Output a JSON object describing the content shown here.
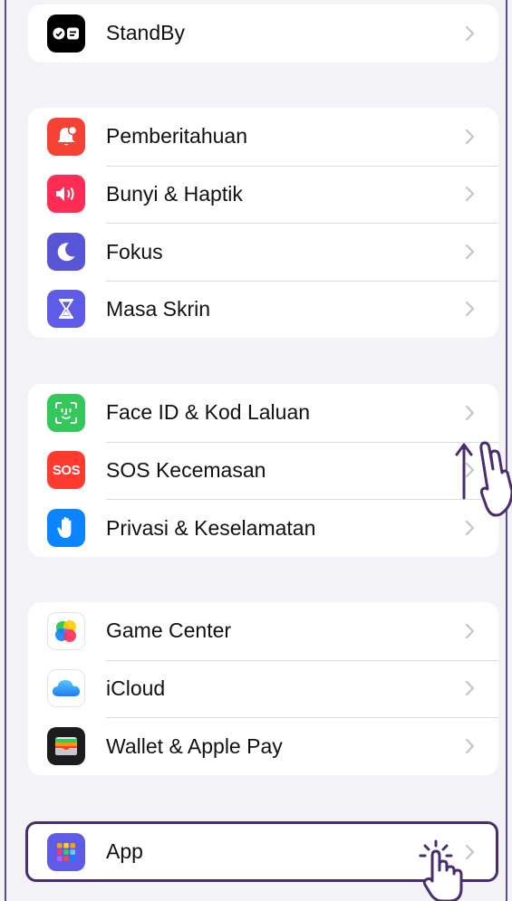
{
  "groups": [
    {
      "items": [
        {
          "label": "StandBy",
          "icon": "standby-icon",
          "color": "#000000"
        }
      ]
    },
    {
      "items": [
        {
          "label": "Pemberitahuan",
          "icon": "bell-icon",
          "color": "#f44336"
        },
        {
          "label": "Bunyi & Haptik",
          "icon": "speaker-icon",
          "color": "#ff2d55"
        },
        {
          "label": "Fokus",
          "icon": "moon-icon",
          "color": "#5856d6"
        },
        {
          "label": "Masa Skrin",
          "icon": "hourglass-icon",
          "color": "#5e5ce6"
        }
      ]
    },
    {
      "items": [
        {
          "label": "Face ID & Kod Laluan",
          "icon": "face-id-icon",
          "color": "#34c759"
        },
        {
          "label": "SOS Kecemasan",
          "icon": "sos-icon",
          "color": "#ff3b30",
          "icon_text": "SOS"
        },
        {
          "label": "Privasi & Keselamatan",
          "icon": "hand-icon",
          "color": "#0a84ff"
        }
      ]
    },
    {
      "items": [
        {
          "label": "Game Center",
          "icon": "game-center-icon",
          "color": "#ffffff"
        },
        {
          "label": "iCloud",
          "icon": "icloud-icon",
          "color": "#ffffff"
        },
        {
          "label": "Wallet & Apple Pay",
          "icon": "wallet-icon",
          "color": "#1c1c1e"
        }
      ]
    },
    {
      "items": [
        {
          "label": "App",
          "icon": "app-grid-icon",
          "color": "#5e5ce6"
        }
      ]
    }
  ],
  "annotations": {
    "highlight_color": "#4a2c72",
    "scroll_gesture": "swipe-up-hand-icon",
    "tap_gesture": "tap-hand-icon"
  }
}
